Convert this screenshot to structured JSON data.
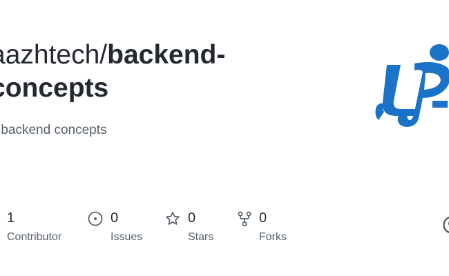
{
  "repo": {
    "owner": "aazhtech/",
    "name": "backend-concepts",
    "name_line1": "backend-",
    "name_line2": "concepts",
    "description": "va backend concepts"
  },
  "stats": [
    {
      "icon": "people-icon",
      "count": "1",
      "label": "Contributor"
    },
    {
      "icon": "issue-opened-icon",
      "count": "0",
      "label": "Issues"
    },
    {
      "icon": "star-icon",
      "count": "0",
      "label": "Stars"
    },
    {
      "icon": "repo-forked-icon",
      "count": "0",
      "label": "Forks"
    }
  ],
  "colors": {
    "title": "#24292f",
    "muted": "#57606a",
    "logo_blue": "#1a73c8"
  }
}
